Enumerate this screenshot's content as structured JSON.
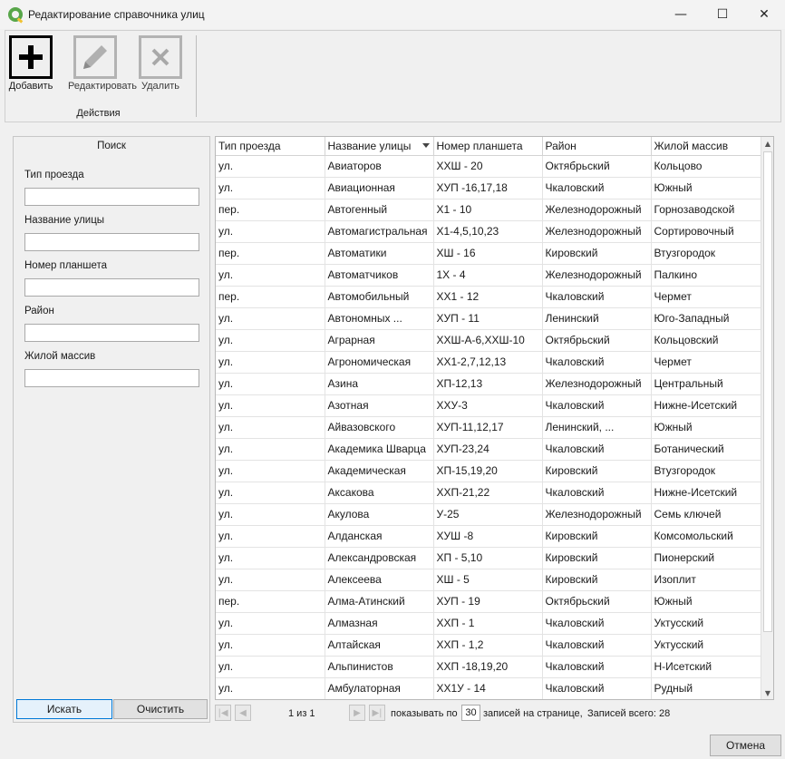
{
  "window": {
    "title": "Редактирование справочника улиц",
    "minimize_glyph": "—",
    "maximize_glyph": "☐",
    "close_glyph": "✕"
  },
  "toolbar": {
    "add_label": "Добавить",
    "edit_label": "Редактировать",
    "delete_label": "Удалить",
    "group_label": "Действия"
  },
  "search": {
    "title": "Поиск",
    "fields": [
      {
        "label": "Тип проезда",
        "value": ""
      },
      {
        "label": "Название улицы",
        "value": ""
      },
      {
        "label": "Номер планшета",
        "value": ""
      },
      {
        "label": "Район",
        "value": ""
      },
      {
        "label": "Жилой массив",
        "value": ""
      }
    ],
    "search_button": "Искать",
    "clear_button": "Очистить"
  },
  "table": {
    "headers": [
      "Тип проезда",
      "Название улицы",
      "Номер планшета",
      "Район",
      "Жилой массив"
    ],
    "sorted_column": 1,
    "rows": [
      [
        "ул.",
        "Авиаторов",
        "ХХШ - 20",
        "Октябрьский",
        "Кольцово"
      ],
      [
        "ул.",
        "Авиационная",
        "ХУП -16,17,18",
        "Чкаловский",
        "Южный"
      ],
      [
        "пер.",
        "Автогенный",
        "Х1 - 10",
        "Железнодорожный",
        "Горнозаводской"
      ],
      [
        "ул.",
        "Автомагистральная",
        "Х1-4,5,10,23",
        "Железнодорожный",
        "Сортировочный"
      ],
      [
        "пер.",
        "Автоматики",
        "ХШ - 16",
        "Кировский",
        "Втузгородок"
      ],
      [
        "ул.",
        "Автоматчиков",
        "1Х - 4",
        "Железнодорожный",
        "Палкино"
      ],
      [
        "пер.",
        "Автомобильный",
        "ХХ1 - 12",
        "Чкаловский",
        "Чермет"
      ],
      [
        "ул.",
        "Автономных ...",
        "ХУП - 11",
        "Ленинский",
        "Юго-Западный"
      ],
      [
        "ул.",
        "Аграрная",
        "ХХШ-А-6,ХХШ-10",
        "Октябрьский",
        "Кольцовский"
      ],
      [
        "ул.",
        "Агрономическая",
        "ХХ1-2,7,12,13",
        "Чкаловский",
        "Чермет"
      ],
      [
        "ул.",
        "Азина",
        "ХП-12,13",
        "Железнодорожный",
        "Центральный"
      ],
      [
        "ул.",
        "Азотная",
        "ХХУ-3",
        "Чкаловский",
        "Нижне-Исетский"
      ],
      [
        "ул.",
        "Айвазовского",
        "ХУП-11,12,17",
        "Ленинский, ...",
        "Южный"
      ],
      [
        "ул.",
        "Академика Шварца",
        "ХУП-23,24",
        "Чкаловский",
        "Ботанический"
      ],
      [
        "ул.",
        "Академическая",
        "ХП-15,19,20",
        "Кировский",
        "Втузгородок"
      ],
      [
        "ул.",
        "Аксакова",
        "ХХП-21,22",
        "Чкаловский",
        "Нижне-Исетский"
      ],
      [
        "ул.",
        "Акулова",
        "У-25",
        "Железнодорожный",
        "Семь ключей"
      ],
      [
        "ул.",
        "Алданская",
        "ХУШ -8",
        "Кировский",
        "Комсомольский"
      ],
      [
        "ул.",
        "Александровская",
        "ХП - 5,10",
        "Кировский",
        "Пионерский"
      ],
      [
        "ул.",
        "Алексеева",
        "ХШ - 5",
        "Кировский",
        "Изоплит"
      ],
      [
        "пер.",
        "Алма-Атинский",
        "ХУП - 19",
        "Октябрьский",
        "Южный"
      ],
      [
        "ул.",
        "Алмазная",
        "ХХП - 1",
        "Чкаловский",
        "Уктусский"
      ],
      [
        "ул.",
        "Алтайская",
        "ХХП - 1,2",
        "Чкаловский",
        "Уктусский"
      ],
      [
        "ул.",
        "Альпинистов",
        "ХХП -18,19,20",
        "Чкаловский",
        "Н-Исетский"
      ],
      [
        "ул.",
        "Амбулаторная",
        "ХХ1У - 14",
        "Чкаловский",
        "Рудный"
      ]
    ]
  },
  "pager": {
    "page_info": "1 из 1",
    "show_label": "показывать по",
    "page_size": "30",
    "per_page_label": "записей на странице,",
    "total_label": "Записей всего: 28"
  },
  "footer": {
    "cancel_button": "Отмена"
  }
}
